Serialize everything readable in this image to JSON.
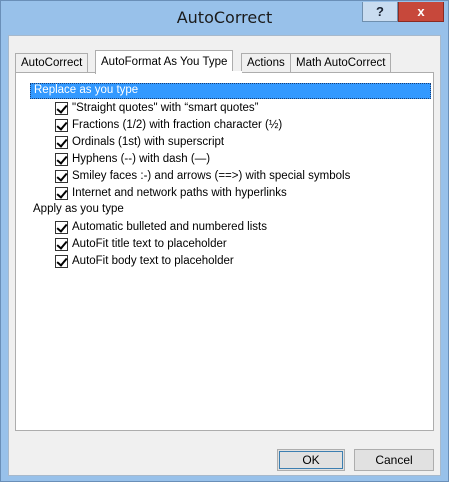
{
  "window": {
    "title": "AutoCorrect",
    "help_label": "?",
    "close_label": "x"
  },
  "tabs": [
    {
      "label": "AutoCorrect",
      "active": false
    },
    {
      "label": "AutoFormat As You Type",
      "active": true
    },
    {
      "label": "Actions",
      "active": false
    },
    {
      "label": "Math AutoCorrect",
      "active": false
    }
  ],
  "replace_group": {
    "header": "Replace as you type",
    "items": [
      {
        "label": "\"Straight quotes\" with “smart quotes”",
        "checked": true
      },
      {
        "label": "Fractions (1/2) with fraction character (½)",
        "checked": true
      },
      {
        "label": "Ordinals (1st) with superscript",
        "checked": true
      },
      {
        "label": "Hyphens (--) with dash (—)",
        "checked": true
      },
      {
        "label": "Smiley faces :-) and arrows (==>) with special symbols",
        "checked": true
      },
      {
        "label": "Internet and network paths with hyperlinks",
        "checked": true
      }
    ]
  },
  "apply_group": {
    "header": "Apply as you type",
    "items": [
      {
        "label": "Automatic bulleted and numbered lists",
        "checked": true
      },
      {
        "label": "AutoFit title text to placeholder",
        "checked": true
      },
      {
        "label": "AutoFit body text to placeholder",
        "checked": true
      }
    ]
  },
  "buttons": {
    "ok": "OK",
    "cancel": "Cancel"
  }
}
